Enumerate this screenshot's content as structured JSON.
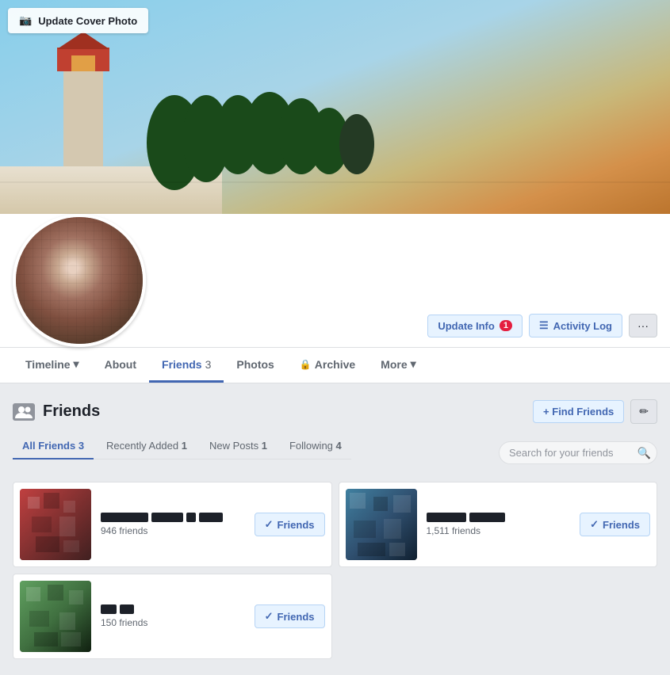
{
  "cover": {
    "update_btn_label": "Update Cover Photo",
    "camera_icon": "📷"
  },
  "profile": {
    "update_info_label": "Update Info",
    "update_info_badge": "1",
    "activity_log_label": "Activity Log",
    "more_label": "···",
    "list_icon": "☰"
  },
  "tabs": [
    {
      "id": "timeline",
      "label": "Timeline",
      "has_dropdown": true,
      "count": null,
      "active": false
    },
    {
      "id": "about",
      "label": "About",
      "has_dropdown": false,
      "count": null,
      "active": false
    },
    {
      "id": "friends",
      "label": "Friends",
      "has_dropdown": false,
      "count": "3",
      "active": true
    },
    {
      "id": "photos",
      "label": "Photos",
      "has_dropdown": false,
      "count": null,
      "active": false
    },
    {
      "id": "archive",
      "label": "Archive",
      "has_dropdown": false,
      "count": null,
      "locked": true,
      "active": false
    },
    {
      "id": "more",
      "label": "More",
      "has_dropdown": true,
      "count": null,
      "active": false
    }
  ],
  "friends_section": {
    "title": "Friends",
    "find_friends_label": "+ Find Friends",
    "edit_icon": "✏",
    "subtabs": [
      {
        "id": "all",
        "label": "All Friends",
        "count": "3",
        "active": true
      },
      {
        "id": "recently_added",
        "label": "Recently Added",
        "count": "1",
        "active": false
      },
      {
        "id": "new_posts",
        "label": "New Posts",
        "count": "1",
        "active": false
      },
      {
        "id": "following",
        "label": "Following",
        "count": "4",
        "active": false
      }
    ],
    "search_placeholder": "Search for your friends",
    "search_icon": "🔍",
    "friends": [
      {
        "id": 1,
        "name_blocks": [
          60,
          40,
          12,
          30
        ],
        "friend_count": "946 friends",
        "btn_label": "Friends",
        "avatar_class": "avatar-1"
      },
      {
        "id": 2,
        "name_blocks": [
          50,
          45
        ],
        "friend_count": "1,511 friends",
        "btn_label": "Friends",
        "avatar_class": "avatar-2"
      },
      {
        "id": 3,
        "name_blocks": [
          20,
          18
        ],
        "friend_count": "150 friends",
        "btn_label": "Friends",
        "avatar_class": "avatar-3"
      }
    ]
  }
}
